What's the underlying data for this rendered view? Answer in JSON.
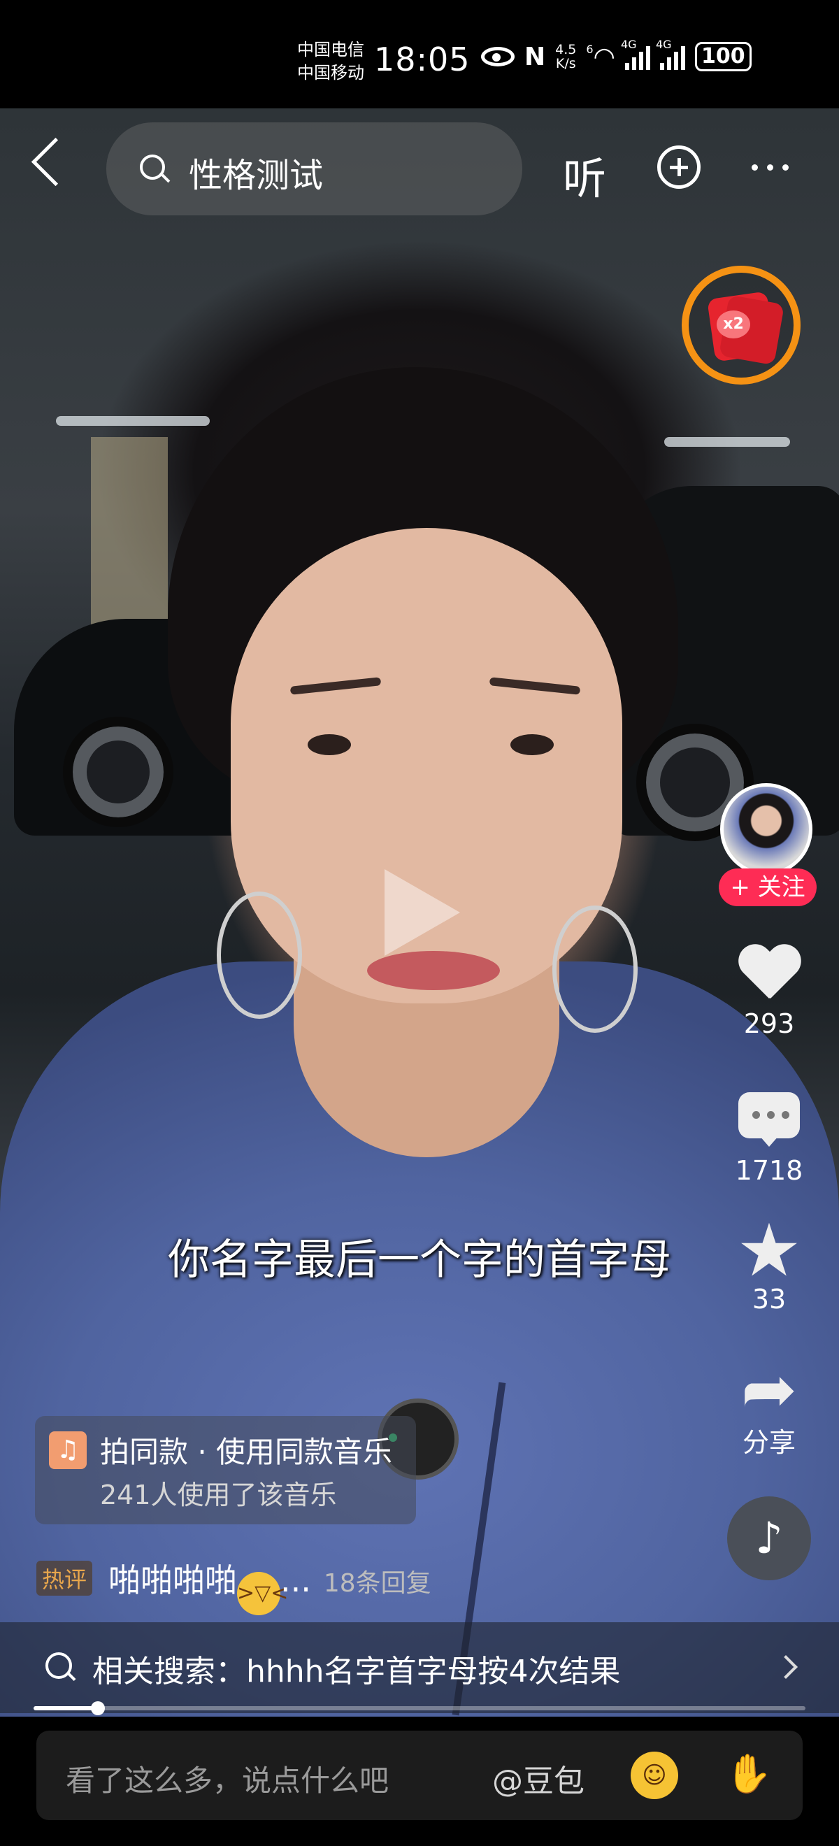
{
  "status_bar": {
    "carrier_1": "中国电信",
    "carrier_2": "中国移动",
    "time": "18:05",
    "net_speed_value": "4.5",
    "net_speed_unit": "K/s",
    "signal_1_tag": "6",
    "signal_2_tag": "4G",
    "signal_3_tag": "4G",
    "battery": "100",
    "icons": [
      "eye-icon",
      "nfc-icon",
      "wifi-icon",
      "signal-icon",
      "battery-icon"
    ]
  },
  "top_nav": {
    "search_text": "性格测试",
    "listen_label": "听",
    "icons": [
      "back-icon",
      "search-icon",
      "plus-icon",
      "more-icon"
    ]
  },
  "red_packet": {
    "badge": "x2",
    "ring_color": "#f59214"
  },
  "right_actions": {
    "follow_label": "+ 关注",
    "likes": "293",
    "comments": "1718",
    "favorites": "33",
    "share_label": "分享",
    "follow_color": "#fe2c55"
  },
  "subtitle": "你名字最后一个字的首字母",
  "music_card": {
    "line1": "拍同款 · 使用同款音乐",
    "line2": "241人使用了该音乐"
  },
  "hot_comment": {
    "tag": "热评",
    "text": "啪啪啪啪",
    "ellipsis": "...",
    "replies": "18条回复"
  },
  "related_search": {
    "text": "相关搜索：hhhh名字首字母按4次结果"
  },
  "progress": {
    "fraction": 0.083
  },
  "comment_bar": {
    "placeholder": "看了这么多，说点什么吧",
    "mention": "@豆包"
  }
}
